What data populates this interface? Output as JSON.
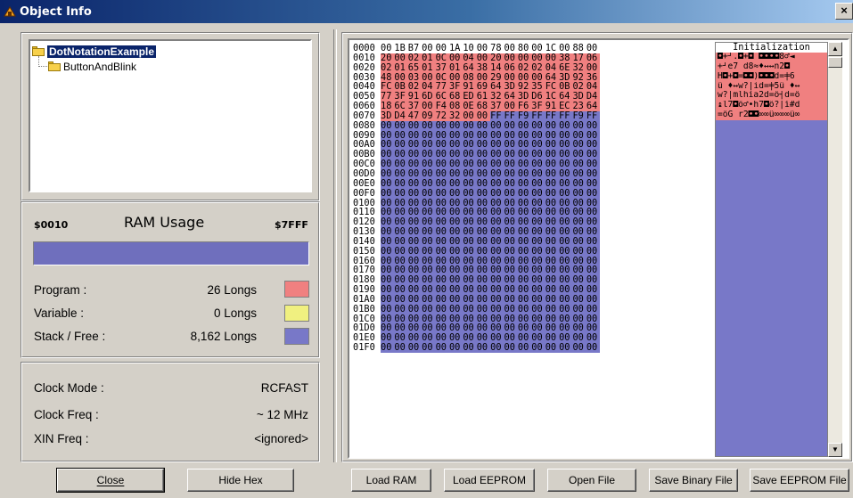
{
  "window": {
    "title": "Object Info",
    "close_glyph": "×"
  },
  "tree": {
    "root": "DotNotationExample",
    "child": "ButtonAndBlink"
  },
  "ram": {
    "start": "$0010",
    "title": "RAM Usage",
    "end": "$7FFF"
  },
  "usage": [
    {
      "label": "Program :",
      "value": "26 Longs",
      "color": "#f08080"
    },
    {
      "label": "Variable :",
      "value": "0 Longs",
      "color": "#f0f080"
    },
    {
      "label": "Stack / Free :",
      "value": "8,162 Longs",
      "color": "#7878c8"
    }
  ],
  "clock": [
    {
      "label": "Clock Mode :",
      "value": "RCFAST"
    },
    {
      "label": "Clock Freq :",
      "value": "~ 12 MHz"
    },
    {
      "label": "XIN Freq :",
      "value": "<ignored>"
    }
  ],
  "buttons": {
    "close": "Close",
    "hide_hex": "Hide Hex",
    "load_ram": "Load RAM",
    "load_eeprom": "Load EEPROM",
    "open_file": "Open File",
    "save_binary": "Save Binary File",
    "save_eeprom": "Save EEPROM File"
  },
  "hex": {
    "ascii_header": "Initialization",
    "rows": [
      {
        "addr": "0000",
        "bytes": "00 1B B7 00 00 1A 10 00 78 00 80 00 1C 00 88 00"
      },
      {
        "addr": "0010",
        "bytes": "20 00 02 01 0C 00 04 00 20 00 00 00 00 38 17 06"
      },
      {
        "addr": "0020",
        "bytes": "02 01 65 01 37 01 64 38 14 06 02 02 04 6E 32 00"
      },
      {
        "addr": "0030",
        "bytes": "48 00 03 00 0C 00 08 00 29 00 00 00 64 3D 92 36"
      },
      {
        "addr": "0040",
        "bytes": "FC 0B 02 04 77 3F 91 69 64 3D 92 35 FC 0B 02 04"
      },
      {
        "addr": "0050",
        "bytes": "77 3F 91 6D 6C 68 ED 61 32 64 3D D6 1C 64 3D D4"
      },
      {
        "addr": "0060",
        "bytes": "18 6C 37 00 F4 08 0E 68 37 00 F6 3F 91 EC 23 64"
      },
      {
        "addr": "0070",
        "bytes": "3D D4 47 09 72 32 00 00 FF FF F9 FF FF FF F9 FF"
      },
      {
        "addr": "0080",
        "bytes": "00 00 00 00 00 00 00 00 00 00 00 00 00 00 00 00"
      },
      {
        "addr": "0090",
        "bytes": "00 00 00 00 00 00 00 00 00 00 00 00 00 00 00 00"
      },
      {
        "addr": "00A0",
        "bytes": "00 00 00 00 00 00 00 00 00 00 00 00 00 00 00 00"
      },
      {
        "addr": "00B0",
        "bytes": "00 00 00 00 00 00 00 00 00 00 00 00 00 00 00 00"
      },
      {
        "addr": "00C0",
        "bytes": "00 00 00 00 00 00 00 00 00 00 00 00 00 00 00 00"
      },
      {
        "addr": "00D0",
        "bytes": "00 00 00 00 00 00 00 00 00 00 00 00 00 00 00 00"
      },
      {
        "addr": "00E0",
        "bytes": "00 00 00 00 00 00 00 00 00 00 00 00 00 00 00 00"
      },
      {
        "addr": "00F0",
        "bytes": "00 00 00 00 00 00 00 00 00 00 00 00 00 00 00 00"
      },
      {
        "addr": "0100",
        "bytes": "00 00 00 00 00 00 00 00 00 00 00 00 00 00 00 00"
      },
      {
        "addr": "0110",
        "bytes": "00 00 00 00 00 00 00 00 00 00 00 00 00 00 00 00"
      },
      {
        "addr": "0120",
        "bytes": "00 00 00 00 00 00 00 00 00 00 00 00 00 00 00 00"
      },
      {
        "addr": "0130",
        "bytes": "00 00 00 00 00 00 00 00 00 00 00 00 00 00 00 00"
      },
      {
        "addr": "0140",
        "bytes": "00 00 00 00 00 00 00 00 00 00 00 00 00 00 00 00"
      },
      {
        "addr": "0150",
        "bytes": "00 00 00 00 00 00 00 00 00 00 00 00 00 00 00 00"
      },
      {
        "addr": "0160",
        "bytes": "00 00 00 00 00 00 00 00 00 00 00 00 00 00 00 00"
      },
      {
        "addr": "0170",
        "bytes": "00 00 00 00 00 00 00 00 00 00 00 00 00 00 00 00"
      },
      {
        "addr": "0180",
        "bytes": "00 00 00 00 00 00 00 00 00 00 00 00 00 00 00 00"
      },
      {
        "addr": "0190",
        "bytes": "00 00 00 00 00 00 00 00 00 00 00 00 00 00 00 00"
      },
      {
        "addr": "01A0",
        "bytes": "00 00 00 00 00 00 00 00 00 00 00 00 00 00 00 00"
      },
      {
        "addr": "01B0",
        "bytes": "00 00 00 00 00 00 00 00 00 00 00 00 00 00 00 00"
      },
      {
        "addr": "01C0",
        "bytes": "00 00 00 00 00 00 00 00 00 00 00 00 00 00 00 00"
      },
      {
        "addr": "01D0",
        "bytes": "00 00 00 00 00 00 00 00 00 00 00 00 00 00 00 00"
      },
      {
        "addr": "01E0",
        "bytes": "00 00 00 00 00 00 00 00 00 00 00 00 00 00 00 00"
      },
      {
        "addr": "01F0",
        "bytes": "00 00 00 00 00 00 00 00 00 00 00 00 00 00 00 00"
      }
    ],
    "program_bytes_highlighted": 120,
    "ascii_rows": [
      "◘+┘.◘+◘ ◘◘◘◘8♂◄",
      "+┘e7 d8≈♦↔↔n2◘",
      "H◘+◘=◘◘)◘◘◘d=╪6",
      "ü ♦↔w?|id=╪5ü ♦↔",
      "w?|mlhía2d=ö┤d=ô",
      "↨l7◘ö♂•h7◘ö?|ì#d",
      "=ôG r2◘◘∞∞ü∞∞∞ü∞"
    ]
  }
}
